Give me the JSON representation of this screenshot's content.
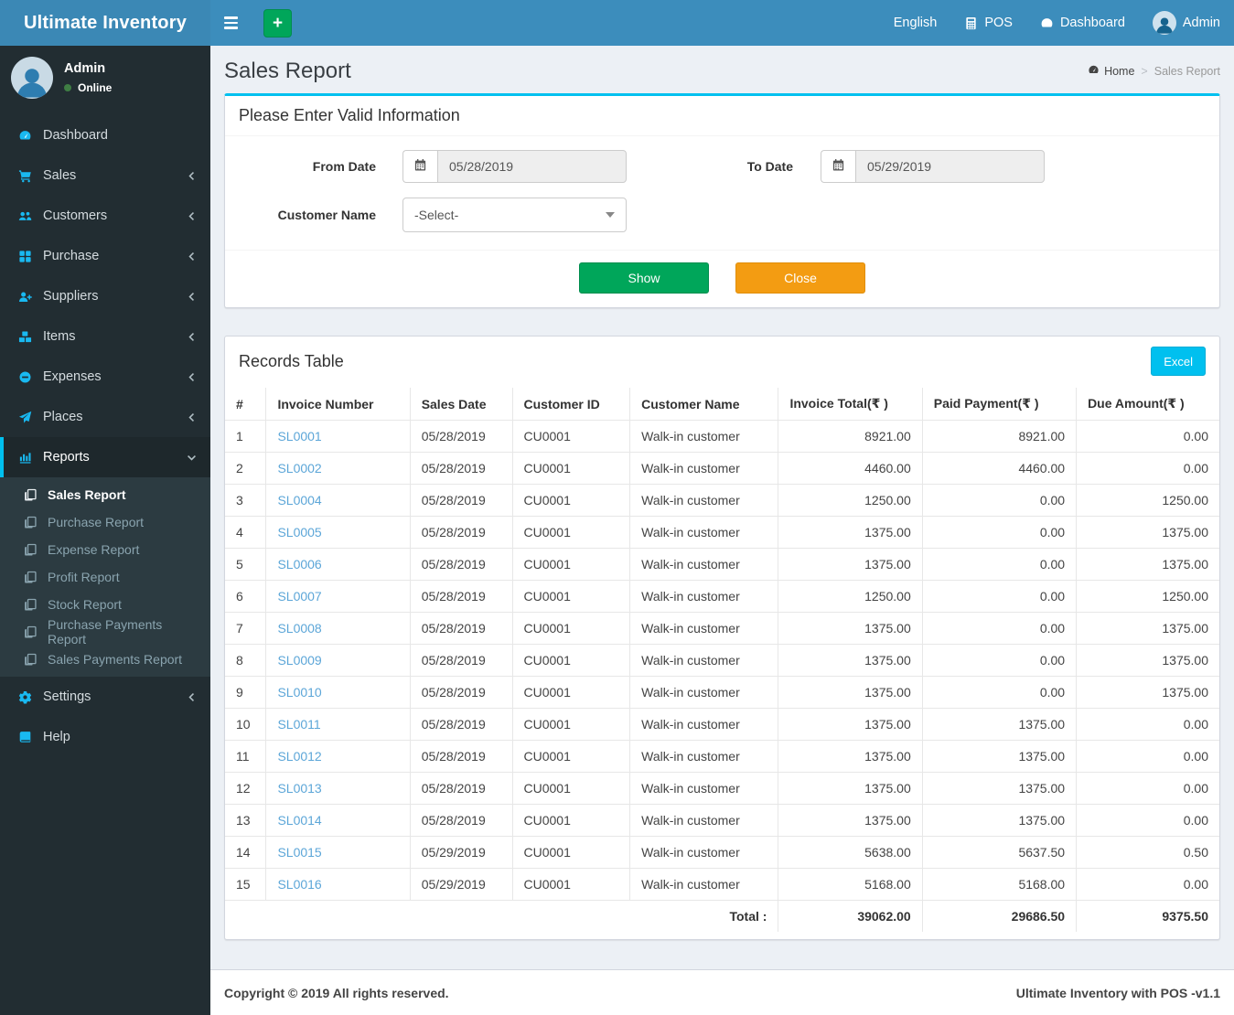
{
  "app": {
    "title": "Ultimate Inventory",
    "footer_left": "Copyright © 2019 All rights reserved.",
    "footer_right": "Ultimate Inventory with POS -v1.1"
  },
  "colors": {
    "navbar": "#3c8dbc",
    "sidebar": "#222d32",
    "submenu": "#2c3b41",
    "accent_cyan": "#00c0ef",
    "icon_blue": "#19b9f1",
    "green": "#00a65a",
    "orange": "#f39c12",
    "link_blue": "#5ca6d8",
    "content_bg": "#ecf0f5"
  },
  "navbar": {
    "links": [
      {
        "label": "English",
        "icon": null
      },
      {
        "label": "POS",
        "icon": "calculator-icon"
      },
      {
        "label": "Dashboard",
        "icon": "gauge-icon"
      },
      {
        "label": "Admin",
        "icon": "avatar"
      }
    ]
  },
  "sidebar": {
    "user": {
      "name": "Admin",
      "status": "Online"
    },
    "items": [
      {
        "label": "Dashboard",
        "icon": "gauge-icon"
      },
      {
        "label": "Sales",
        "icon": "cart-icon",
        "chevron": true
      },
      {
        "label": "Customers",
        "icon": "users-icon",
        "chevron": true
      },
      {
        "label": "Purchase",
        "icon": "grid-icon",
        "chevron": true
      },
      {
        "label": "Suppliers",
        "icon": "user-plus-icon",
        "chevron": true
      },
      {
        "label": "Items",
        "icon": "cubes-icon",
        "chevron": true
      },
      {
        "label": "Expenses",
        "icon": "minus-circle-icon",
        "chevron": true
      },
      {
        "label": "Places",
        "icon": "paper-plane-icon",
        "chevron": true
      },
      {
        "label": "Reports",
        "icon": "bar-chart-icon",
        "active": true,
        "expanded": true,
        "children": [
          {
            "label": "Sales Report",
            "active": true
          },
          {
            "label": "Purchase Report"
          },
          {
            "label": "Expense Report"
          },
          {
            "label": "Profit Report"
          },
          {
            "label": "Stock Report"
          },
          {
            "label": "Purchase Payments Report"
          },
          {
            "label": "Sales Payments Report"
          }
        ]
      },
      {
        "label": "Settings",
        "icon": "gears-icon",
        "chevron": true
      },
      {
        "label": "Help",
        "icon": "book-icon"
      }
    ]
  },
  "page": {
    "title": "Sales Report",
    "breadcrumb": {
      "home": "Home",
      "current": "Sales Report"
    }
  },
  "filter_panel": {
    "title": "Please Enter Valid Information",
    "from_date": {
      "label": "From Date",
      "value": "05/28/2019"
    },
    "to_date": {
      "label": "To Date",
      "value": "05/29/2019"
    },
    "customer": {
      "label": "Customer Name",
      "value": "-Select-"
    },
    "show_label": "Show",
    "close_label": "Close"
  },
  "records": {
    "title": "Records Table",
    "excel_label": "Excel",
    "columns": [
      "#",
      "Invoice Number",
      "Sales Date",
      "Customer ID",
      "Customer Name",
      "Invoice Total(₹ )",
      "Paid Payment(₹ )",
      "Due Amount(₹ )"
    ],
    "rows": [
      [
        "1",
        "SL0001",
        "05/28/2019",
        "CU0001",
        "Walk-in customer",
        "8921.00",
        "8921.00",
        "0.00"
      ],
      [
        "2",
        "SL0002",
        "05/28/2019",
        "CU0001",
        "Walk-in customer",
        "4460.00",
        "4460.00",
        "0.00"
      ],
      [
        "3",
        "SL0004",
        "05/28/2019",
        "CU0001",
        "Walk-in customer",
        "1250.00",
        "0.00",
        "1250.00"
      ],
      [
        "4",
        "SL0005",
        "05/28/2019",
        "CU0001",
        "Walk-in customer",
        "1375.00",
        "0.00",
        "1375.00"
      ],
      [
        "5",
        "SL0006",
        "05/28/2019",
        "CU0001",
        "Walk-in customer",
        "1375.00",
        "0.00",
        "1375.00"
      ],
      [
        "6",
        "SL0007",
        "05/28/2019",
        "CU0001",
        "Walk-in customer",
        "1250.00",
        "0.00",
        "1250.00"
      ],
      [
        "7",
        "SL0008",
        "05/28/2019",
        "CU0001",
        "Walk-in customer",
        "1375.00",
        "0.00",
        "1375.00"
      ],
      [
        "8",
        "SL0009",
        "05/28/2019",
        "CU0001",
        "Walk-in customer",
        "1375.00",
        "0.00",
        "1375.00"
      ],
      [
        "9",
        "SL0010",
        "05/28/2019",
        "CU0001",
        "Walk-in customer",
        "1375.00",
        "0.00",
        "1375.00"
      ],
      [
        "10",
        "SL0011",
        "05/28/2019",
        "CU0001",
        "Walk-in customer",
        "1375.00",
        "1375.00",
        "0.00"
      ],
      [
        "11",
        "SL0012",
        "05/28/2019",
        "CU0001",
        "Walk-in customer",
        "1375.00",
        "1375.00",
        "0.00"
      ],
      [
        "12",
        "SL0013",
        "05/28/2019",
        "CU0001",
        "Walk-in customer",
        "1375.00",
        "1375.00",
        "0.00"
      ],
      [
        "13",
        "SL0014",
        "05/28/2019",
        "CU0001",
        "Walk-in customer",
        "1375.00",
        "1375.00",
        "0.00"
      ],
      [
        "14",
        "SL0015",
        "05/29/2019",
        "CU0001",
        "Walk-in customer",
        "5638.00",
        "5637.50",
        "0.50"
      ],
      [
        "15",
        "SL0016",
        "05/29/2019",
        "CU0001",
        "Walk-in customer",
        "5168.00",
        "5168.00",
        "0.00"
      ]
    ],
    "total_label": "Total :",
    "totals": [
      "39062.00",
      "29686.50",
      "9375.50"
    ]
  }
}
